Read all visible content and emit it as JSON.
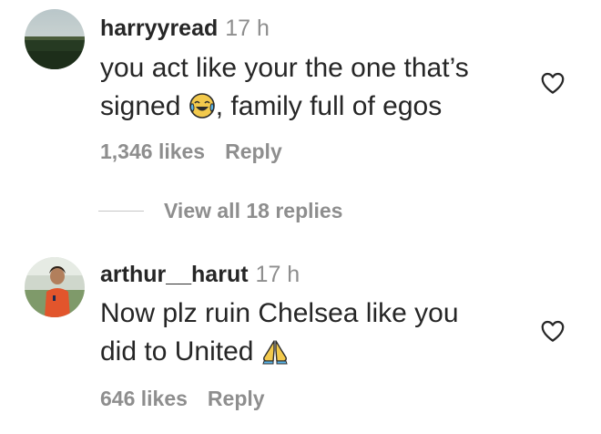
{
  "comments": [
    {
      "username": "harryyread",
      "time": "17 h",
      "text_line1": "you act like your the one that’s",
      "text_line2_before": "signed ",
      "text_line2_after": ", family full of egos",
      "emoji": "tears-of-joy-emoji",
      "likes": "1,346 likes",
      "reply_label": "Reply"
    },
    {
      "username": "arthur__harut",
      "time": "17 h",
      "text_line1": "Now plz ruin Chelsea like you",
      "text_line2_before": "did to United ",
      "emoji": "folded-hands-emoji",
      "likes": "646 likes",
      "reply_label": "Reply"
    }
  ],
  "view_replies": {
    "label": "View all 18 replies"
  },
  "icons": {
    "like": "heart-outline-icon"
  },
  "colors": {
    "text": "#262626",
    "secondary": "#8e8e8e",
    "divider": "#c7c7c7"
  }
}
